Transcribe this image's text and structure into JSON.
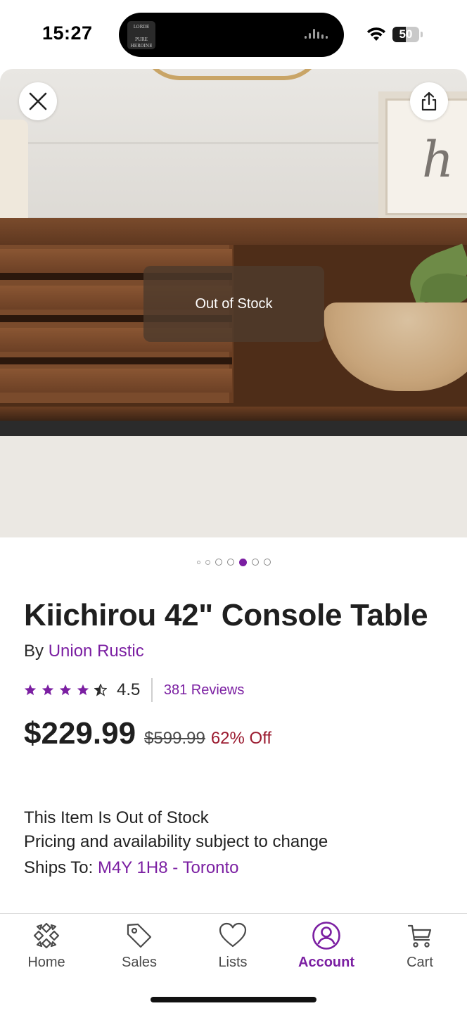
{
  "status_bar": {
    "time": "15:27",
    "battery": "50",
    "battery_level": 0.5,
    "now_playing_art_text": "LORDE PURE HEROINE"
  },
  "product": {
    "overlay_text": "Out of Stock",
    "title": "Kiichirou 42\" Console Table",
    "by_prefix": "By",
    "brand": "Union Rustic",
    "rating": "4.5",
    "rating_value": 4.5,
    "reviews": "381 Reviews",
    "price": "$229.99",
    "original_price": "$599.99",
    "discount": "62% Off",
    "availability_line1": "This Item Is Out of Stock",
    "availability_line2": "Pricing and availability subject to change",
    "ships_to_label": "Ships To:",
    "ships_to_value": "M4Y 1H8 - Toronto"
  },
  "gallery": {
    "dot_count": 7,
    "active_dot": 4
  },
  "tabs": [
    {
      "label": "Home",
      "icon": "home-icon",
      "active": false
    },
    {
      "label": "Sales",
      "icon": "tag-icon",
      "active": false
    },
    {
      "label": "Lists",
      "icon": "heart-icon",
      "active": false
    },
    {
      "label": "Account",
      "icon": "account-icon",
      "active": true
    },
    {
      "label": "Cart",
      "icon": "cart-icon",
      "active": false
    }
  ],
  "colors": {
    "accent": "#7b1fa2",
    "discount": "#9b1b30",
    "overlay": "#4e3a2c"
  }
}
